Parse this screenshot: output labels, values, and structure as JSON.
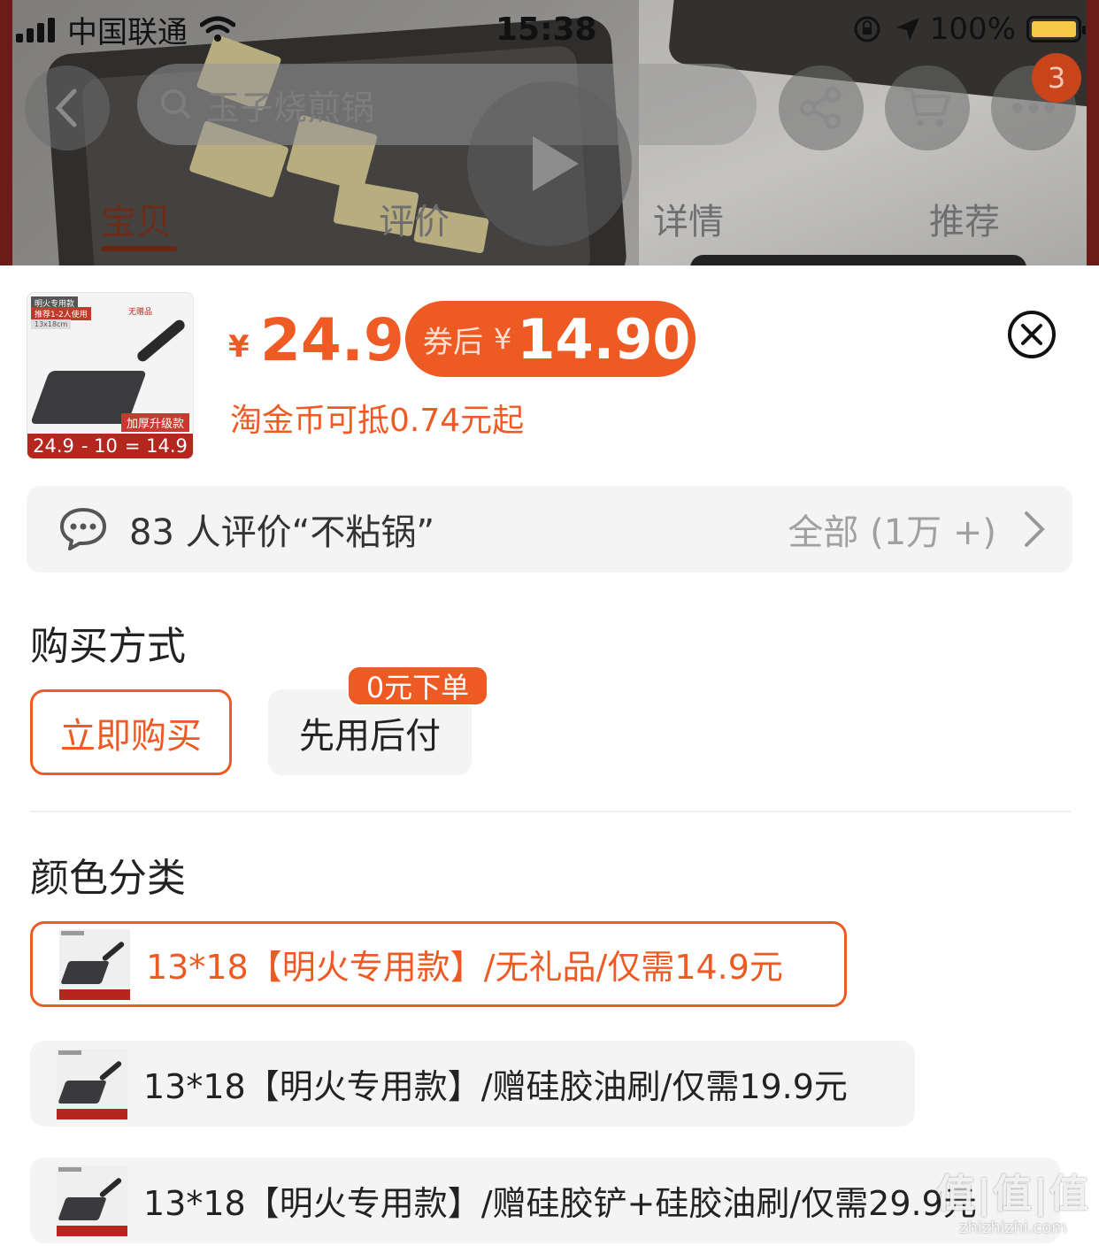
{
  "status_bar": {
    "carrier": "中国联通",
    "time": "15:38",
    "battery": "100%"
  },
  "nav": {
    "search_placeholder": "玉子烧煎锅",
    "cart_count": "3",
    "tabs": [
      {
        "label": "宝贝",
        "active": true
      },
      {
        "label": "评价",
        "active": false
      },
      {
        "label": "详情",
        "active": false
      },
      {
        "label": "推荐",
        "active": false
      }
    ]
  },
  "product": {
    "thumb": {
      "tag_top": "明火专用款",
      "tag_recommend": "推荐1-2人使用",
      "tag_size": "13x18cm",
      "gift": "无赠品",
      "upgrade": "加厚升级款",
      "price_formula": [
        "24.9",
        "- 10",
        "= 14.9"
      ]
    },
    "price_symbol": "¥",
    "price": "24.9",
    "coupon_label": "券后",
    "coupon_symbol": "¥",
    "coupon_price": "14.90",
    "taojin_note": "淘金币可抵0.74元起"
  },
  "reviews": {
    "summary": "83 人评价“不粘锅”",
    "all_label": "全部 (1万 +)"
  },
  "purchase": {
    "title": "购买方式",
    "buy_now": "立即购买",
    "pay_later": "先用后付",
    "pay_later_badge": "0元下单"
  },
  "colors": {
    "title": "颜色分类",
    "options": [
      {
        "label": "13*18【明火专用款】/无礼品/仅需14.9元",
        "selected": true
      },
      {
        "label": "13*18【明火专用款】/赠硅胶油刷/仅需19.9元",
        "selected": false
      },
      {
        "label": "13*18【明火专用款】/赠硅胶铲+硅胶油刷/仅需29.9元",
        "selected": false
      }
    ]
  },
  "watermark": {
    "main": "值|值|值",
    "site": "zhizhizhi.com"
  },
  "theme": {
    "accent": "#ee5a24",
    "muted_bg": "#f4f4f4"
  }
}
